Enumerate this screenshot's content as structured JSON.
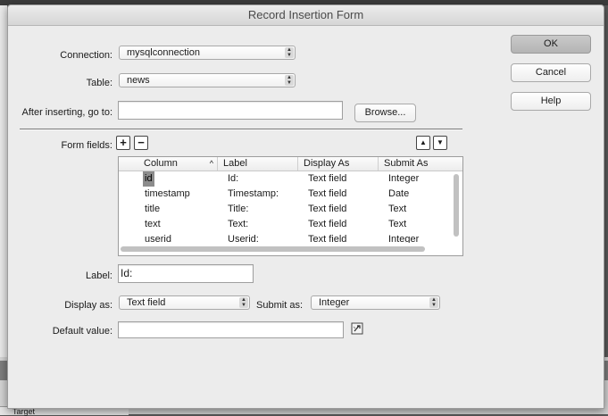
{
  "dialog": {
    "title": "Record Insertion Form"
  },
  "form": {
    "connection_label": "Connection:",
    "connection_value": "mysqlconnection",
    "table_label": "Table:",
    "table_value": "news",
    "after_label": "After inserting, go to:",
    "after_value": "",
    "browse_label": "Browse...",
    "form_fields_label": "Form fields:"
  },
  "buttons": {
    "ok": "OK",
    "cancel": "Cancel",
    "help": "Help"
  },
  "fields_table": {
    "headers": [
      "Column",
      "Label",
      "Display As",
      "Submit As"
    ],
    "rows": [
      {
        "column": "id",
        "label": "Id:",
        "display": "Text field",
        "submit": "Integer"
      },
      {
        "column": "timestamp",
        "label": "Timestamp:",
        "display": "Text field",
        "submit": "Date"
      },
      {
        "column": "title",
        "label": "Title:",
        "display": "Text field",
        "submit": "Text"
      },
      {
        "column": "text",
        "label": "Text:",
        "display": "Text field",
        "submit": "Text"
      },
      {
        "column": "userid",
        "label": "Userid:",
        "display": "Text field",
        "submit": "Integer"
      }
    ],
    "selected_row": 0
  },
  "detail": {
    "label_label": "Label:",
    "label_value": "Id:",
    "display_label": "Display as:",
    "display_value": "Text field",
    "submit_label": "Submit as:",
    "submit_value": "Integer",
    "default_label": "Default value:",
    "default_value": ""
  },
  "background": {
    "tab_label": "Target"
  },
  "icons": [
    "plus-icon",
    "minus-icon",
    "move-up-icon",
    "move-down-icon",
    "dynamic-data-icon",
    "sort-ascending-icon"
  ]
}
